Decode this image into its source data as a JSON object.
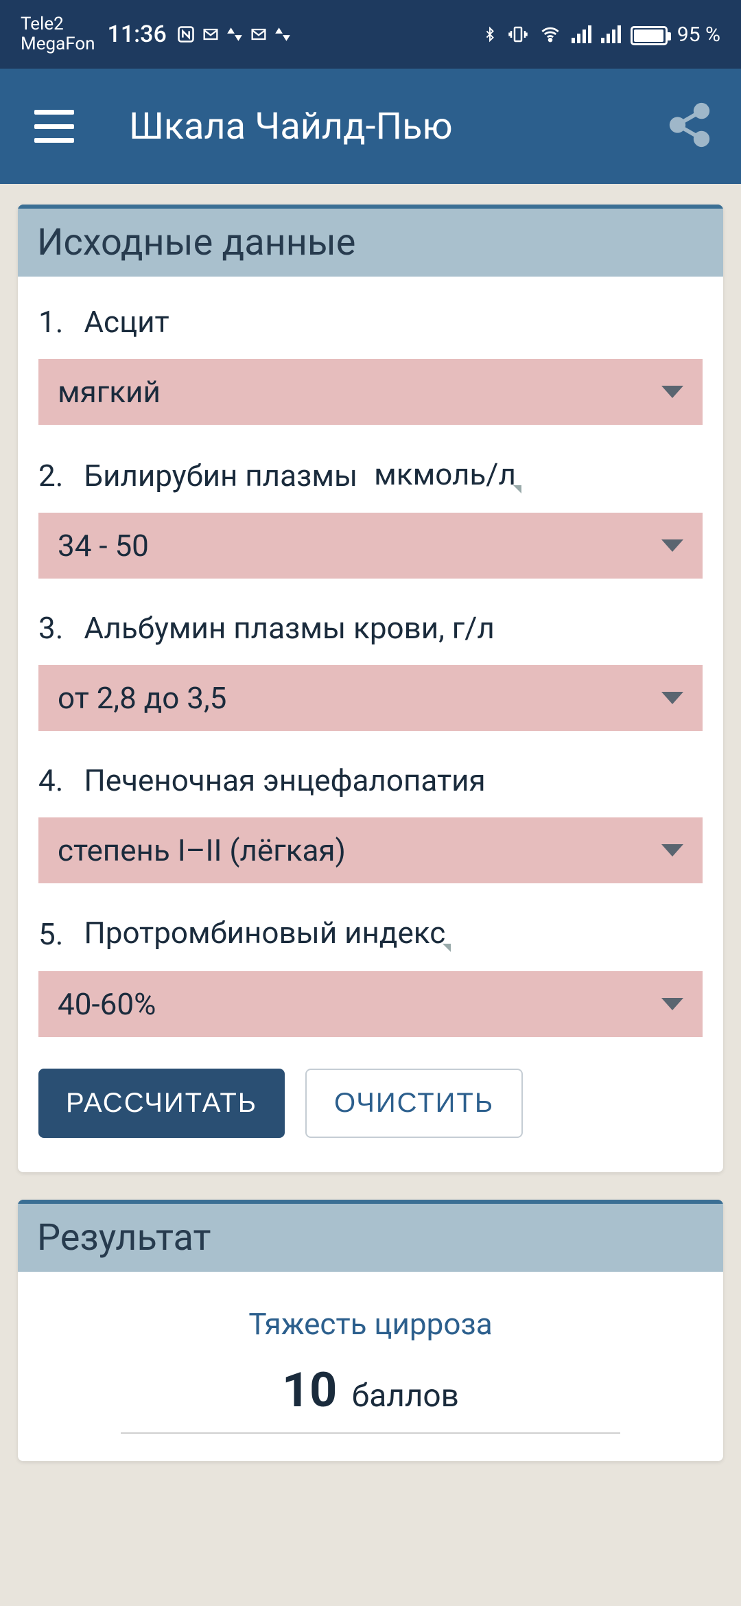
{
  "status": {
    "carrier1": "Tele2",
    "carrier2": "MegaFon",
    "time": "11:36",
    "battery_pct": "95 %"
  },
  "app": {
    "title": "Шкала Чайлд-Пью"
  },
  "input_card": {
    "header": "Исходные данные",
    "fields": [
      {
        "num": "1.",
        "label": "Асцит",
        "value": "мягкий"
      },
      {
        "num": "2.",
        "label": "Билирубин плазмы",
        "unit": "мкмоль/л",
        "value": "34 - 50"
      },
      {
        "num": "3.",
        "label": "Альбумин плазмы крови, г/л",
        "value": "от 2,8 до 3,5"
      },
      {
        "num": "4.",
        "label": "Печеночная энцефалопатия",
        "value": "степень I–II (лёгкая)"
      },
      {
        "num": "5.",
        "label": "Протромбиновый индекс",
        "has_unit_triangle": true,
        "value": "40-60%"
      }
    ],
    "calc_button": "РАССЧИТАТЬ",
    "clear_button": "ОЧИСТИТЬ"
  },
  "result_card": {
    "header": "Результат",
    "title": "Тяжесть цирроза",
    "score": "10",
    "score_unit": "баллов"
  }
}
